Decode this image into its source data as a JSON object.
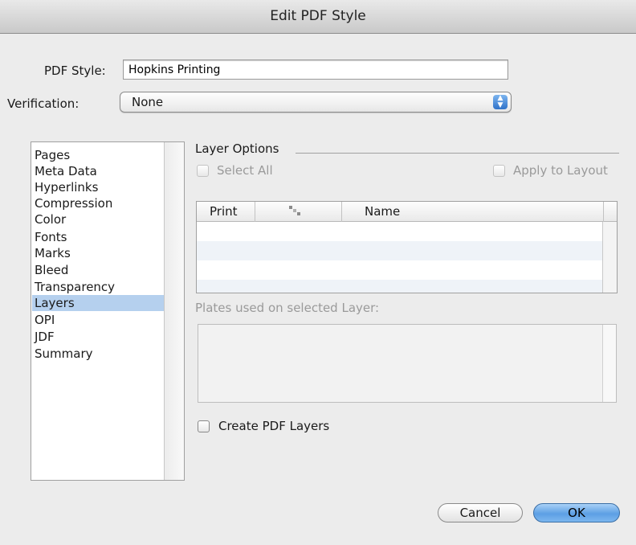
{
  "window": {
    "title": "Edit PDF Style"
  },
  "form": {
    "pdf_style_label": "PDF Style:",
    "pdf_style_value": "Hopkins Printing",
    "verification_label": "Verification:",
    "verification_value": "None"
  },
  "sidebar": {
    "items": [
      {
        "label": "Pages"
      },
      {
        "label": "Meta Data"
      },
      {
        "label": "Hyperlinks"
      },
      {
        "label": "Compression"
      },
      {
        "label": "Color"
      },
      {
        "label": "Fonts"
      },
      {
        "label": "Marks"
      },
      {
        "label": "Bleed"
      },
      {
        "label": "Transparency"
      },
      {
        "label": "Layers"
      },
      {
        "label": "OPI"
      },
      {
        "label": "JDF"
      },
      {
        "label": "Summary"
      }
    ],
    "selected": "Layers"
  },
  "layer_options": {
    "group_title": "Layer Options",
    "select_all_label": "Select All",
    "apply_to_layout_label": "Apply to Layout",
    "columns": [
      "Print",
      "",
      "Name"
    ],
    "rows": [],
    "plates_label": "Plates used on selected Layer:",
    "create_pdf_layers_label": "Create PDF Layers"
  },
  "buttons": {
    "cancel_label": "Cancel",
    "ok_label": "OK"
  },
  "colors": {
    "selection": "#b5d0ee",
    "default_button": "#5d9fe4"
  }
}
